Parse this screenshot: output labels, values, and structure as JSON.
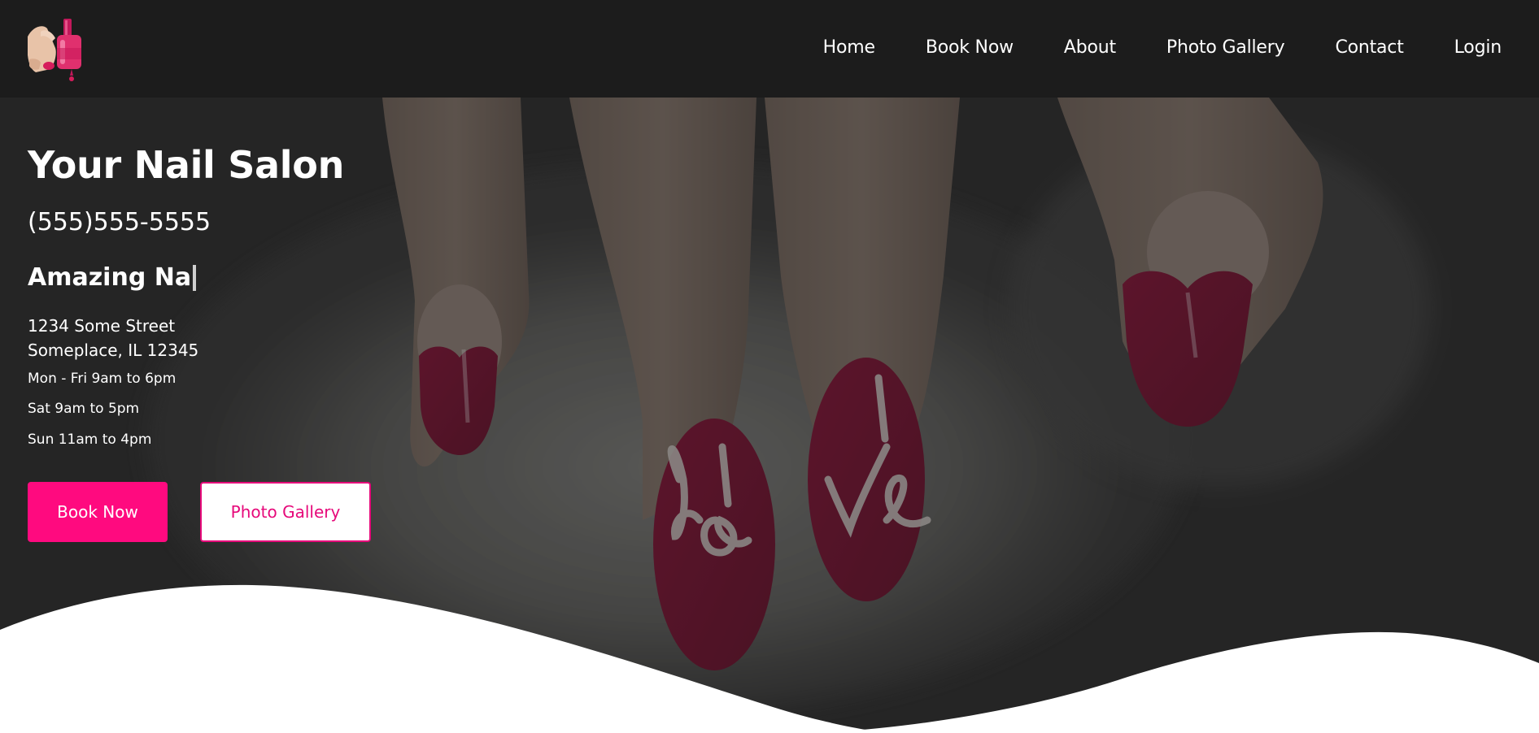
{
  "nav": {
    "items": [
      {
        "label": "Home"
      },
      {
        "label": "Book Now"
      },
      {
        "label": "About"
      },
      {
        "label": "Photo Gallery"
      },
      {
        "label": "Contact"
      },
      {
        "label": "Login"
      }
    ]
  },
  "hero": {
    "salon_name": "Your Nail Salon",
    "phone": "(555)555-5555",
    "typed_text": "Amazing Na",
    "address_line1": "1234 Some Street",
    "address_line2": "Someplace, IL 12345",
    "hours": [
      "Mon - Fri 9am to 6pm",
      "Sat 9am to 5pm",
      "Sun 11am to 4pm"
    ],
    "buttons": {
      "book_label": "Book Now",
      "gallery_label": "Photo Gallery"
    },
    "background_image": "painted-nails-love-photo"
  },
  "colors": {
    "header_bg": "#1c1c1c",
    "accent": "#ff0a7f",
    "nail_red": "#a3163d",
    "text": "#ffffff"
  }
}
